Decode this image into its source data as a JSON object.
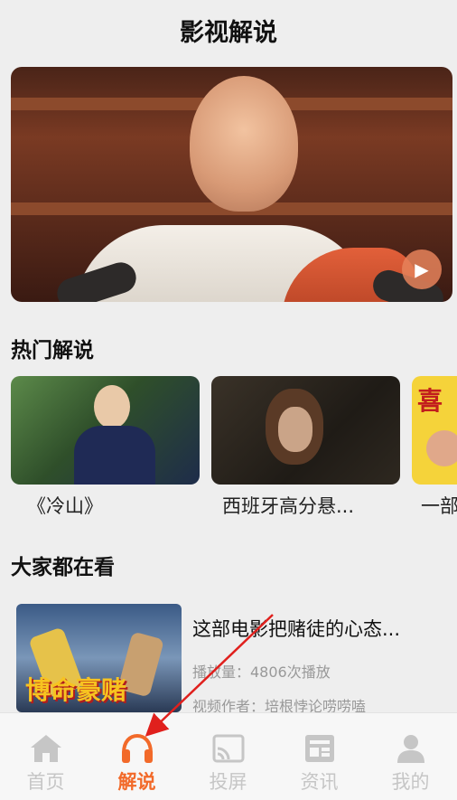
{
  "header": {
    "title": "影视解说"
  },
  "sections": {
    "hot": "热门解说",
    "watching": "大家都在看"
  },
  "hot_items": [
    {
      "label": "《冷山》"
    },
    {
      "label": "西班牙高分悬..."
    },
    {
      "label": "一部"
    }
  ],
  "watch_item": {
    "title": "这部电影把赌徒的心态...",
    "plays": "播放量：4806次播放",
    "author": "视频作者：培根悖论唠唠嗑",
    "thumb_text": "博命豪赌"
  },
  "tabs": [
    {
      "label": "首页",
      "icon": "home-icon"
    },
    {
      "label": "解说",
      "icon": "headphones-icon",
      "active": true
    },
    {
      "label": "投屏",
      "icon": "cast-icon"
    },
    {
      "label": "资讯",
      "icon": "news-icon"
    },
    {
      "label": "我的",
      "icon": "user-icon"
    }
  ],
  "colors": {
    "accent": "#f26a2a",
    "inactive": "#c6c6c6",
    "arrow": "#e0201d"
  }
}
